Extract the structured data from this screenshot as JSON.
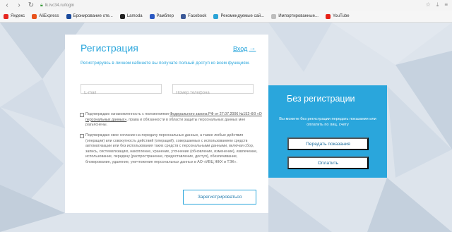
{
  "browser": {
    "url": "lk.ivc34.ru/login",
    "bookmarks": [
      {
        "label": "Яндекс",
        "icon": "yandex-icon",
        "color": "#e52620"
      },
      {
        "label": "AliExpress",
        "icon": "aliexpress-icon",
        "color": "#e8531d"
      },
      {
        "label": "Бронирование оте...",
        "icon": "booking-icon",
        "color": "#1a4a9c"
      },
      {
        "label": "Lamoda",
        "icon": "lamoda-icon",
        "color": "#222222"
      },
      {
        "label": "Рамблер",
        "icon": "rambler-icon",
        "color": "#2b59c3"
      },
      {
        "label": "Facebook",
        "icon": "facebook-icon",
        "color": "#3b5998"
      },
      {
        "label": "Рекомендуемые сай...",
        "icon": "recommended-icon",
        "color": "#2aa3d6"
      },
      {
        "label": "Импортированные...",
        "icon": "folder-icon",
        "color": "#bdbdbd"
      },
      {
        "label": "YouTube",
        "icon": "youtube-icon",
        "color": "#e62117"
      }
    ]
  },
  "registration": {
    "title": "Регистрация",
    "login_link": "Вход",
    "intro": "Регистрируясь в личном кабинете вы получате полный доступ ко всем функциям.",
    "email_placeholder": "E-mail",
    "phone_placeholder": "Номер телефона",
    "consent1_pre": "Подтверждаю ознакомленность с положениями ",
    "consent1_link": "Федерального закона РФ от 27.07.2006 №152-ФЗ «О персональных данных»",
    "consent1_post": ", права и обязанности в области защиты персональных данных мне разъяснены.",
    "consent2": "Подтверждаю свое согласие на передачу персональных данных, а также любые действия (операции) или совокупность действий (операций), совершаемых с использованием средств автоматизации или без использования таких средств с персональными данными, включая сбор, запись, систематизацию, накопление, хранение, уточнение (обновление, изменение), извлечение, использование, передачу (распространение, предоставление, доступ), обезличивание, блокирование, удаление, уничтожение персональных данных в АО «ИВЦ ЖКХ и ТЭК».",
    "submit_label": "Зарегистрироваться"
  },
  "no_registration": {
    "title": "Без регистрации",
    "text": "Вы можете без регистрации передать показания или оплатить по лиц. счету",
    "submit_readings_label": "Передать показания",
    "pay_label": "Оплатить"
  },
  "colors": {
    "accent": "#2aa6dc",
    "background": "#dfe6ee"
  }
}
